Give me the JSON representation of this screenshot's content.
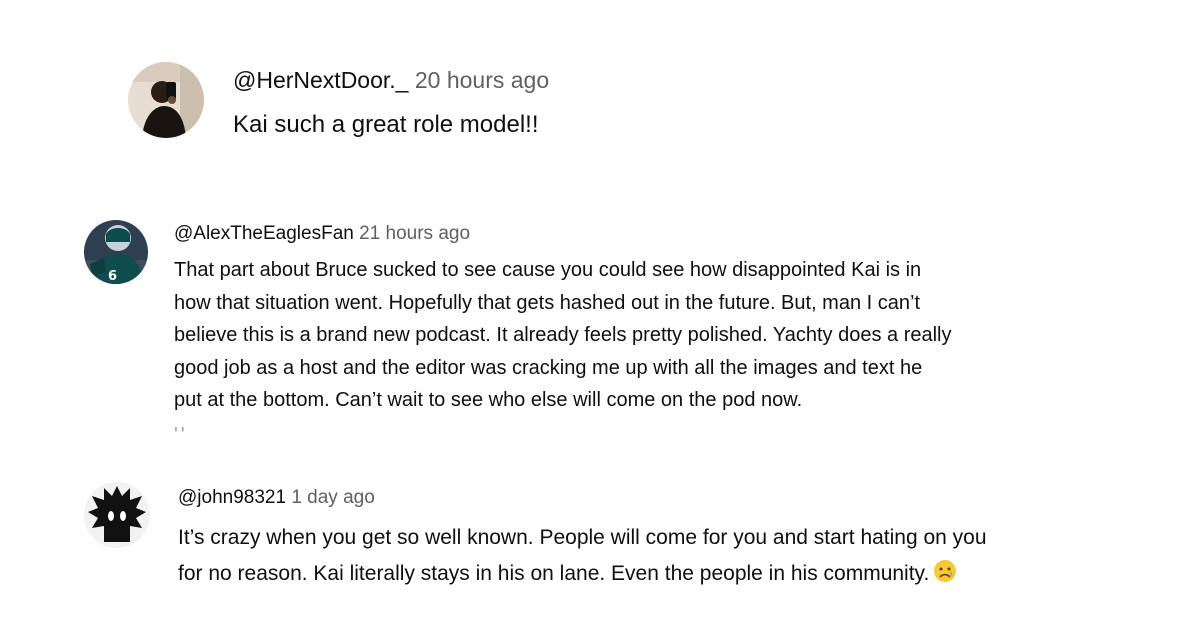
{
  "comments": [
    {
      "handle": "@HerNextDoor._",
      "time": "20 hours ago",
      "lines": [
        "Kai such a great role model!!"
      ]
    },
    {
      "handle": "@AlexTheEaglesFan",
      "time": "21 hours ago",
      "lines": [
        "That part about Bruce sucked to see cause you could see how disappointed Kai is in",
        "how that situation went. Hopefully that gets hashed out in the future. But, man I can’t",
        "believe this is a brand new podcast. It already feels pretty polished. Yachty does a really",
        "good job as a host and the editor was cracking me up with all the images and text he",
        "put at the bottom. Can’t wait to see who else will come on the pod now."
      ],
      "avatar_jersey_number": "6"
    },
    {
      "handle": "@john98321",
      "time": "1 day ago",
      "lines": [
        "It’s crazy when you get so well known. People will come for you and start hating on you",
        "for no reason. Kai literally stays in his on lane. Even the people in his community."
      ],
      "trailing_emoji": "sad-tear-emoji"
    }
  ],
  "colors": {
    "text": "#0f0f0f",
    "timestamp": "#606060",
    "background": "#ffffff"
  }
}
